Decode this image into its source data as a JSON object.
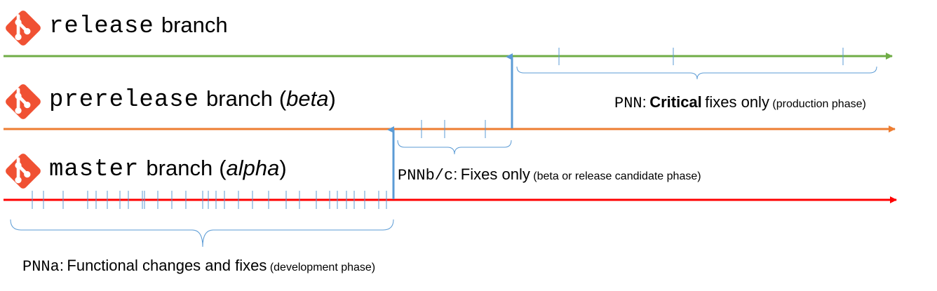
{
  "colors": {
    "release": "#70ad47",
    "prerelease": "#ed7d31",
    "master": "#ff0000",
    "merge_arrow": "#5b9bd5",
    "git_logo": "#f05133"
  },
  "icons": {
    "branch_logo": "git-logo-icon"
  },
  "branches": {
    "release": {
      "mono": "release",
      "word": "branch",
      "paren_open": "",
      "paren_italic": "",
      "paren_close": ""
    },
    "prerelease": {
      "mono": "prerelease",
      "word": "branch",
      "paren_open": "(",
      "paren_italic": "beta",
      "paren_close": ")"
    },
    "master": {
      "mono": "master",
      "word": "branch",
      "paren_open": "(",
      "paren_italic": "alpha",
      "paren_close": ")"
    }
  },
  "phases": {
    "release": {
      "code": "PNN",
      "colon": ":",
      "bold": "Critical",
      "text": "fixes only",
      "small": "(production phase)"
    },
    "prerelease": {
      "code": "PNNb/c",
      "colon": ":",
      "text": "Fixes only",
      "small": "(beta or release candidate phase)"
    },
    "master": {
      "code": "PNNa",
      "colon": ":",
      "text": "Functional changes and fixes",
      "small": "(development phase)"
    }
  }
}
